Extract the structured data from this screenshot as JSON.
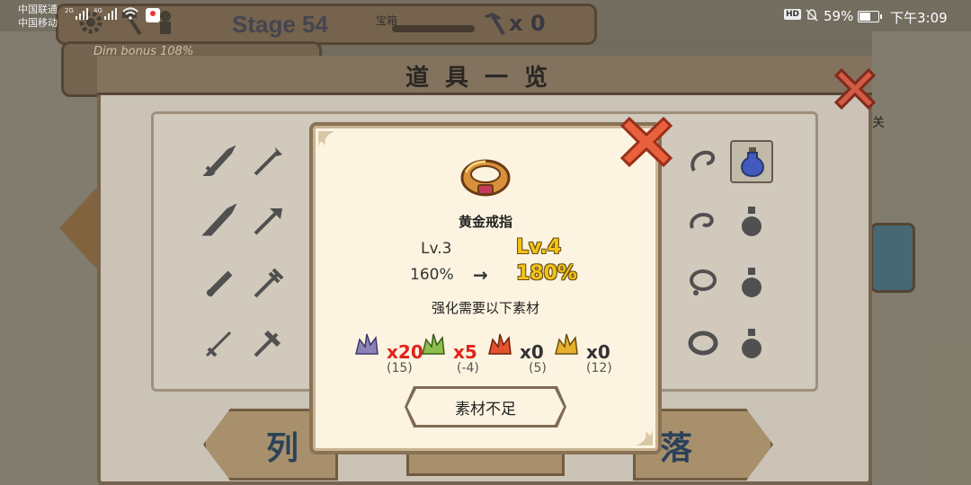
{
  "status_bar": {
    "carrier_1": "中国联通",
    "carrier_2": "中国移动",
    "signal_1_tag": "2G",
    "signal_2_tag": "4G",
    "battery": "59%",
    "time": "下午3:09",
    "icons": [
      "wifi-icon",
      "map-app-icon",
      "hd-icon",
      "mute-icon",
      "battery-icon"
    ]
  },
  "game_hud": {
    "stage": "Stage 54",
    "chest_label": "宝箱",
    "pickaxe_count": "x 0",
    "dim_bonus": "Dim bonus  108%",
    "side_label": "关"
  },
  "items_panel": {
    "title": "道具一览",
    "tab_left": "列",
    "tab_right": "落",
    "close_icon": "close-x-icon"
  },
  "item_popup": {
    "item_name": "黄金戒指",
    "level_current": "Lv.3",
    "level_next": "Lv.4",
    "bonus_current": "160%",
    "arrow": "→",
    "bonus_next": "180%",
    "requirement_text": "强化需要以下素材",
    "materials": [
      {
        "icon": "purple-crystal-icon",
        "required": "x20",
        "owned": "(15)",
        "color": "#8a84b8"
      },
      {
        "icon": "green-crystal-icon",
        "required": "x5",
        "owned": "(-4)",
        "color": "#8cbf4a"
      },
      {
        "icon": "red-crystal-icon",
        "required": "x0",
        "owned": "(5)",
        "color": "#e4532c"
      },
      {
        "icon": "gold-crystal-icon",
        "required": "x0",
        "owned": "(12)",
        "color": "#e6b02a"
      }
    ],
    "button_label": "素材不足"
  },
  "colors": {
    "popup_bg": "#fcf4e1",
    "accent_gold": "#f2c21a",
    "alert_red": "#e0231a",
    "close_red": "#e8613d"
  }
}
